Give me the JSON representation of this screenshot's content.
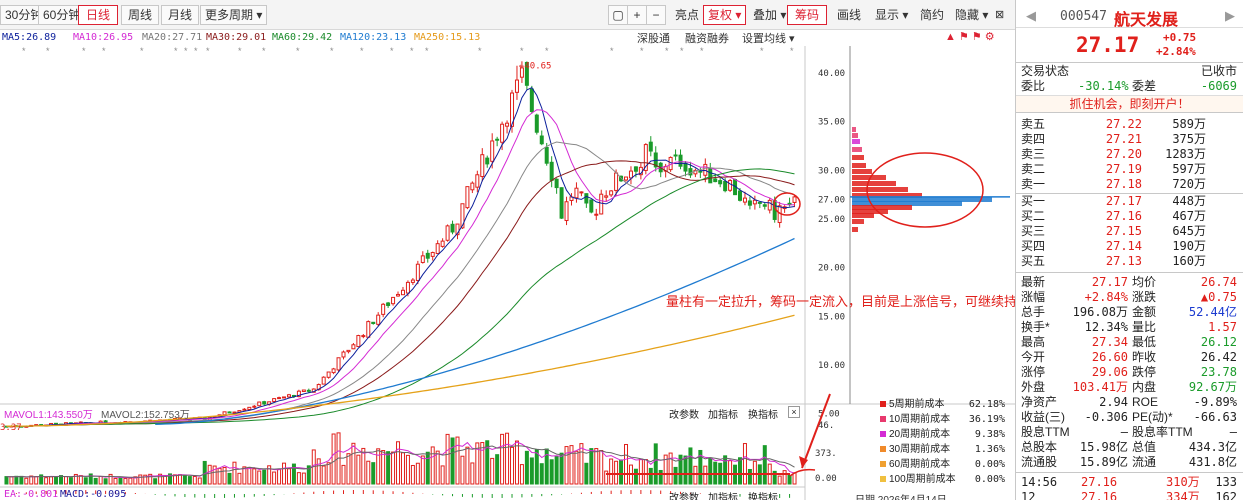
{
  "toolbar": {
    "items": [
      "30分钟",
      "60分钟",
      "日线",
      "周线",
      "月线",
      "更多周期"
    ],
    "right": [
      "亮点",
      "复权",
      "叠加",
      "筹码",
      "画线",
      "显示",
      "简约",
      "隐藏"
    ]
  },
  "ma": {
    "ma5": "MA5:26.89",
    "ma10": "MA10:26.95",
    "ma20": "MA20:27.71",
    "ma30": "MA30:29.01",
    "ma60": "MA60:29.42",
    "ma120": "MA120:23.13",
    "ma250": "MA250:15.13"
  },
  "menu2": [
    "深股通",
    "融资融券",
    "设置均线"
  ],
  "chart_data": {
    "type": "candlestick",
    "y_ticks": [
      "40.00",
      "35.00",
      "30.00",
      "27.00",
      "25.00",
      "20.00",
      "15.00",
      "10.00",
      "5.00"
    ],
    "high_label": "40.65",
    "low_label": "3.37",
    "vol_ticks": [
      "46.",
      "373.",
      "0.00"
    ],
    "annotation": "量柱有一定拉升，筹码一定流入，目前是上涨信号，可继续持股"
  },
  "subchart": {
    "vol_title": "MAVOL1:143.550万",
    "vol2": "MAVOL2:152.753万",
    "macd_title": "EA:-0.801",
    "macd": "MACD:-0.095",
    "buttons": [
      "改参数",
      "加指标",
      "换指标"
    ]
  },
  "legend": [
    {
      "label": "5周期前成本",
      "pct": "62.18%",
      "color": "#e0201b"
    },
    {
      "label": "10周期前成本",
      "pct": "36.19%",
      "color": "#e8396e"
    },
    {
      "label": "20周期前成本",
      "pct": "9.38%",
      "color": "#d42ad4"
    },
    {
      "label": "30周期前成本",
      "pct": "1.36%",
      "color": "#f08a2a"
    },
    {
      "label": "60周期前成本",
      "pct": "0.00%",
      "color": "#f0a030"
    },
    {
      "label": "100周期前成本",
      "pct": "0.00%",
      "color": "#f0c040"
    }
  ],
  "date_label": "日期 2026年4月14日",
  "quote": {
    "code": "000547",
    "name": "航天发展",
    "price": "27.17",
    "change": "+0.75",
    "pct": "+2.84%",
    "status_l": "交易状态",
    "status_r": "已收市",
    "weibi_l": "委比",
    "weibi_v": "-30.14%",
    "weicha_l": "委差",
    "weicha_v": "-6069",
    "promo": "抓住机会，即刻开户！"
  },
  "sells": [
    {
      "l": "卖五",
      "p": "27.22",
      "v": "589万"
    },
    {
      "l": "卖四",
      "p": "27.21",
      "v": "375万"
    },
    {
      "l": "卖三",
      "p": "27.20",
      "v": "1283万"
    },
    {
      "l": "卖二",
      "p": "27.19",
      "v": "597万"
    },
    {
      "l": "卖一",
      "p": "27.18",
      "v": "720万"
    }
  ],
  "buys": [
    {
      "l": "买一",
      "p": "27.17",
      "v": "448万"
    },
    {
      "l": "买二",
      "p": "27.16",
      "v": "467万"
    },
    {
      "l": "买三",
      "p": "27.15",
      "v": "645万"
    },
    {
      "l": "买四",
      "p": "27.14",
      "v": "190万"
    },
    {
      "l": "买五",
      "p": "27.13",
      "v": "160万"
    }
  ],
  "stats": [
    {
      "l1": "最新",
      "v1": "27.17",
      "c1": "up",
      "l2": "均价",
      "v2": "26.74",
      "c2": "up"
    },
    {
      "l1": "涨幅",
      "v1": "+2.84%",
      "c1": "up",
      "l2": "涨跌",
      "v2": "▲0.75",
      "c2": "up"
    },
    {
      "l1": "总手",
      "v1": "196.08万",
      "c1": "",
      "l2": "金额",
      "v2": "52.44亿",
      "c2": "bl"
    },
    {
      "l1": "换手*",
      "v1": "12.34%",
      "c1": "",
      "l2": "量比",
      "v2": "1.57",
      "c2": "up"
    },
    {
      "l1": "最高",
      "v1": "27.34",
      "c1": "up",
      "l2": "最低",
      "v2": "26.12",
      "c2": "dn"
    },
    {
      "l1": "今开",
      "v1": "26.60",
      "c1": "up",
      "l2": "昨收",
      "v2": "26.42",
      "c2": ""
    },
    {
      "l1": "涨停",
      "v1": "29.06",
      "c1": "up",
      "l2": "跌停",
      "v2": "23.78",
      "c2": "dn"
    },
    {
      "l1": "外盘",
      "v1": "103.41万",
      "c1": "up",
      "l2": "内盘",
      "v2": "92.67万",
      "c2": "dn"
    },
    {
      "l1": "净资产",
      "v1": "2.94",
      "c1": "",
      "l2": "ROE",
      "v2": "-9.89%",
      "c2": ""
    },
    {
      "l1": "收益(三)",
      "v1": "-0.306",
      "c1": "",
      "l2": "PE(动)*",
      "v2": "-66.63",
      "c2": ""
    },
    {
      "l1": "股息TTM",
      "v1": "—",
      "c1": "",
      "l2": "股息率TTM",
      "v2": "—",
      "c2": ""
    },
    {
      "l1": "总股本",
      "v1": "15.98亿",
      "c1": "",
      "l2": "总值",
      "v2": "434.3亿",
      "c2": ""
    },
    {
      "l1": "流通股",
      "v1": "15.89亿",
      "c1": "",
      "l2": "流通",
      "v2": "431.8亿",
      "c2": ""
    }
  ],
  "ticks": [
    {
      "t": "14:56",
      "p": "27.16",
      "v": "310万",
      "n": "133"
    },
    {
      "t": "12",
      "p": "27.16",
      "v": "334万",
      "n": "162"
    }
  ]
}
